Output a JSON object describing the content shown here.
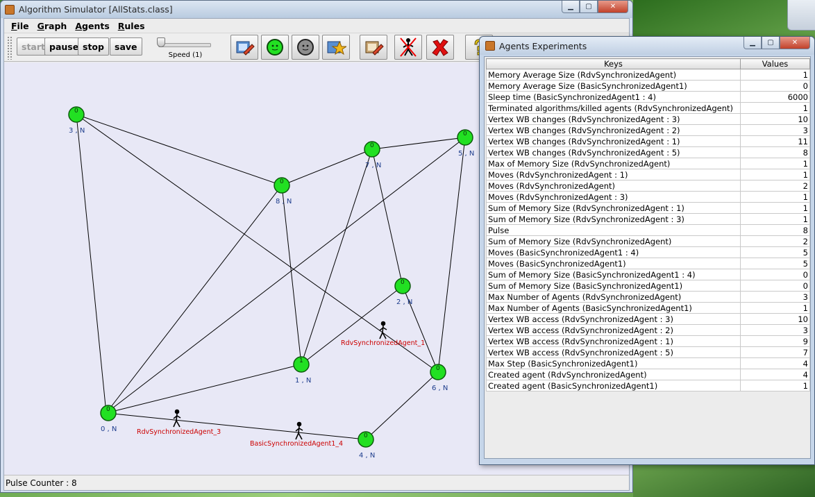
{
  "main_window": {
    "title": "Algorithm Simulator [AllStats.class]",
    "controls": {
      "minimize": "▁",
      "maximize": "▢",
      "close": "✕"
    }
  },
  "menu": [
    "File",
    "Graph",
    "Agents",
    "Rules"
  ],
  "toolbar": {
    "start": "start",
    "pause": "pause",
    "stop": "stop",
    "save": "save",
    "speed_label": "Speed (1)",
    "icons": [
      "edit-graph-icon",
      "green-node-icon",
      "gray-node-icon",
      "star-tool-icon",
      "edit-agent-icon",
      "kill-agent-icon",
      "red-cross-icon",
      "help-icon"
    ]
  },
  "graph": {
    "nodes": [
      {
        "id": "n3",
        "value": "0",
        "label": "3 , N"
      },
      {
        "id": "n8",
        "value": "0",
        "label": "8 , N"
      },
      {
        "id": "n7",
        "value": "0",
        "label": "7 , N"
      },
      {
        "id": "n5",
        "value": "0",
        "label": "5 , N"
      },
      {
        "id": "n2",
        "value": "0",
        "label": "2 , N"
      },
      {
        "id": "n1",
        "value": "1",
        "label": "1 , N"
      },
      {
        "id": "n6",
        "value": "0",
        "label": "6 , N"
      },
      {
        "id": "n0",
        "value": "0",
        "label": "0 , N"
      },
      {
        "id": "n4",
        "value": "0",
        "label": "4 , N"
      }
    ],
    "agents": [
      {
        "name": "RdvSynchronizedAgent_1"
      },
      {
        "name": "RdvSynchronizedAgent_3"
      },
      {
        "name": "BasicSynchronizedAgent1_4"
      }
    ]
  },
  "status": {
    "pulse_counter": "Pulse Counter : 8"
  },
  "stats_window": {
    "title": "Agents Experiments",
    "controls": {
      "minimize": "▁",
      "maximize": "▢",
      "close": "✕"
    },
    "columns": [
      "Keys",
      "Values"
    ],
    "rows": [
      [
        "Memory Average Size (RdvSynchronizedAgent)",
        "1"
      ],
      [
        "Memory Average Size (BasicSynchronizedAgent1)",
        "0"
      ],
      [
        "Sleep time (BasicSynchronizedAgent1 : 4)",
        "6000"
      ],
      [
        "Terminated algorithms/killed agents (RdvSynchronizedAgent)",
        "1"
      ],
      [
        "Vertex WB changes (RdvSynchronizedAgent : 3)",
        "10"
      ],
      [
        "Vertex WB changes (RdvSynchronizedAgent : 2)",
        "3"
      ],
      [
        "Vertex WB changes (RdvSynchronizedAgent : 1)",
        "11"
      ],
      [
        "Vertex WB changes (RdvSynchronizedAgent : 5)",
        "8"
      ],
      [
        "Max of Memory Size (RdvSynchronizedAgent)",
        "1"
      ],
      [
        "Moves (RdvSynchronizedAgent : 1)",
        "1"
      ],
      [
        "Moves (RdvSynchronizedAgent)",
        "2"
      ],
      [
        "Moves (RdvSynchronizedAgent : 3)",
        "1"
      ],
      [
        "Sum of Memory Size (RdvSynchronizedAgent : 1)",
        "1"
      ],
      [
        "Sum of Memory Size (RdvSynchronizedAgent : 3)",
        "1"
      ],
      [
        "Pulse",
        "8"
      ],
      [
        "Sum of Memory Size (RdvSynchronizedAgent)",
        "2"
      ],
      [
        "Moves (BasicSynchronizedAgent1 : 4)",
        "5"
      ],
      [
        "Moves (BasicSynchronizedAgent1)",
        "5"
      ],
      [
        "Sum of Memory Size (BasicSynchronizedAgent1 : 4)",
        "0"
      ],
      [
        "Sum of Memory Size (BasicSynchronizedAgent1)",
        "0"
      ],
      [
        "Max Number of Agents (RdvSynchronizedAgent)",
        "3"
      ],
      [
        "Max Number of Agents (BasicSynchronizedAgent1)",
        "1"
      ],
      [
        "Vertex WB access (RdvSynchronizedAgent : 3)",
        "10"
      ],
      [
        "Vertex WB access (RdvSynchronizedAgent : 2)",
        "3"
      ],
      [
        "Vertex WB access (RdvSynchronizedAgent : 1)",
        "9"
      ],
      [
        "Vertex WB access (RdvSynchronizedAgent : 5)",
        "7"
      ],
      [
        "Max Step (BasicSynchronizedAgent1)",
        "4"
      ],
      [
        "Created agent (RdvSynchronizedAgent)",
        "4"
      ],
      [
        "Created agent (BasicSynchronizedAgent1)",
        "1"
      ]
    ]
  }
}
